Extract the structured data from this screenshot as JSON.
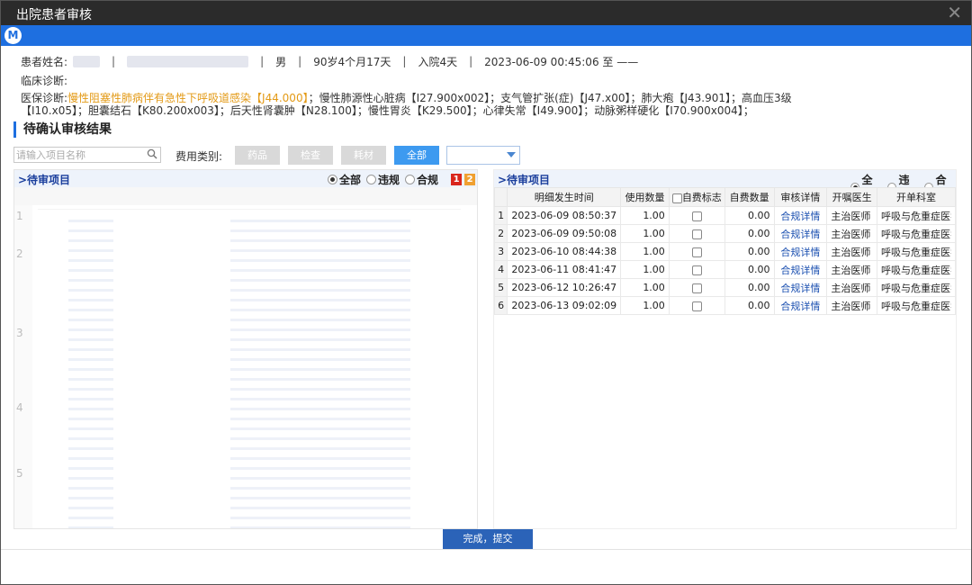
{
  "window": {
    "title": "出院患者审核",
    "logo": "M"
  },
  "patient": {
    "name_label": "患者姓名:",
    "gender": "男",
    "age": "90岁4个月17天",
    "stay": "入院4天",
    "admit_time": "2023-06-09 00:45:06 至 ——",
    "clinical_label": "临床诊断:"
  },
  "diagnosis": {
    "label": "医保诊断:",
    "first": "慢性阻塞性肺病伴有急性下呼吸道感染【J44.000】",
    "line1_rest": "；慢性肺源性心脏病【I27.900x002】；支气管扩张(症)【J47.x00】；肺大疱【J43.901】；高血压3级",
    "line2": "【I10.x05】；胆囊结石【K80.200x003】；后天性肾囊肿【N28.100】；慢性胃炎【K29.500】；心律失常【I49.900】；动脉粥样硬化【I70.900x004】；"
  },
  "section_title": "待确认审核结果",
  "filter": {
    "search_placeholder": "请输入项目名称",
    "fee_label": "费用类别:",
    "buttons": [
      "药品",
      "检查",
      "耗材",
      "全部"
    ],
    "active": "全部"
  },
  "left_panel": {
    "title": ">待审项目",
    "radios": [
      "全部",
      "违规",
      "合规"
    ],
    "badges": [
      "1",
      "2"
    ],
    "row_count": 6
  },
  "right_panel": {
    "title": ">待审项目",
    "radios": [
      "全部",
      "违规",
      "合规"
    ],
    "columns": [
      "明细发生时间",
      "使用数量",
      "自费标志",
      "自费数量",
      "审核详情",
      "开嘱医生",
      "开单科室"
    ],
    "rows": [
      {
        "idx": "1",
        "time": "2023-06-09 08:50:37",
        "qty": "1.00",
        "self_qty": "0.00",
        "detail": "合规详情",
        "doctor": "主治医师",
        "dept": "呼吸与危重症医学科"
      },
      {
        "idx": "2",
        "time": "2023-06-09 09:50:08",
        "qty": "1.00",
        "self_qty": "0.00",
        "detail": "合规详情",
        "doctor": "主治医师",
        "dept": "呼吸与危重症医学科"
      },
      {
        "idx": "3",
        "time": "2023-06-10 08:44:38",
        "qty": "1.00",
        "self_qty": "0.00",
        "detail": "合规详情",
        "doctor": "主治医师",
        "dept": "呼吸与危重症医学科"
      },
      {
        "idx": "4",
        "time": "2023-06-11 08:41:47",
        "qty": "1.00",
        "self_qty": "0.00",
        "detail": "合规详情",
        "doctor": "主治医师",
        "dept": "呼吸与危重症医学科"
      },
      {
        "idx": "5",
        "time": "2023-06-12 10:26:47",
        "qty": "1.00",
        "self_qty": "0.00",
        "detail": "合规详情",
        "doctor": "主治医师",
        "dept": "呼吸与危重症医学科"
      },
      {
        "idx": "6",
        "time": "2023-06-13 09:02:09",
        "qty": "1.00",
        "self_qty": "0.00",
        "detail": "合规详情",
        "doctor": "主治医师",
        "dept": "呼吸与危重症医学科"
      }
    ]
  },
  "submit_label": "完成，提交",
  "colors": {
    "accent": "#1e6fe0",
    "titlebar": "#2b2b2b",
    "warning_text": "#e39a16",
    "link": "#1a4fb0"
  }
}
